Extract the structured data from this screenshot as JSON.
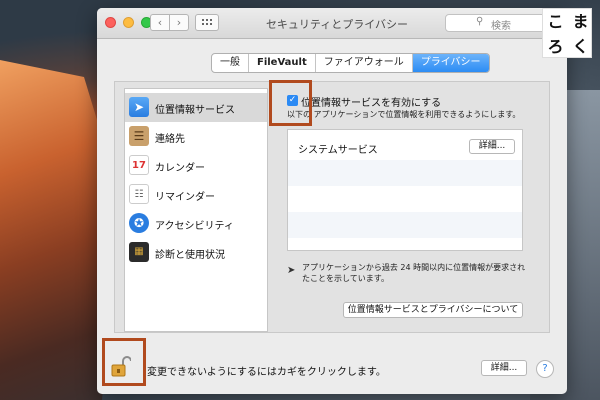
{
  "window": {
    "title": "セキュリティとプライバシー",
    "search_placeholder": "検索"
  },
  "badge": {
    "chars": [
      "こ",
      "ま",
      "ろ",
      "く"
    ]
  },
  "tabs": [
    {
      "label": "一般",
      "active": false
    },
    {
      "label": "FileVault",
      "active": false
    },
    {
      "label": "ファイアウォール",
      "active": false
    },
    {
      "label": "プライバシー",
      "active": true
    }
  ],
  "sidebar": {
    "items": [
      {
        "label": "位置情報サービス",
        "icon": "location-arrow-icon",
        "selected": true
      },
      {
        "label": "連絡先",
        "icon": "contacts-book-icon",
        "selected": false
      },
      {
        "label": "カレンダー",
        "icon": "calendar-icon",
        "selected": false
      },
      {
        "label": "リマインダー",
        "icon": "reminders-icon",
        "selected": false
      },
      {
        "label": "アクセシビリティ",
        "icon": "accessibility-icon",
        "selected": false
      },
      {
        "label": "診断と使用状況",
        "icon": "diagnostics-icon",
        "selected": false
      }
    ]
  },
  "location": {
    "enable_label": "位置情報サービスを有効にする",
    "enabled": true,
    "sub_prefix": "以下の",
    "sub_rest": "アプリケーションで位置情報を利用できるようにします。",
    "list_first_item": "システムサービス",
    "details_button": "詳細...",
    "note": "アプリケーションから過去 24 時間以内に位置情報が要求されたことを示しています。",
    "about_button": "位置情報サービスとプライバシーについて"
  },
  "footer": {
    "lock_text": "変更できないようにするにはカギをクリックします。",
    "details_button": "詳細...",
    "help_label": "?"
  },
  "colors": {
    "accent": "#2b8af4",
    "highlight_box": "#b14a1e"
  }
}
